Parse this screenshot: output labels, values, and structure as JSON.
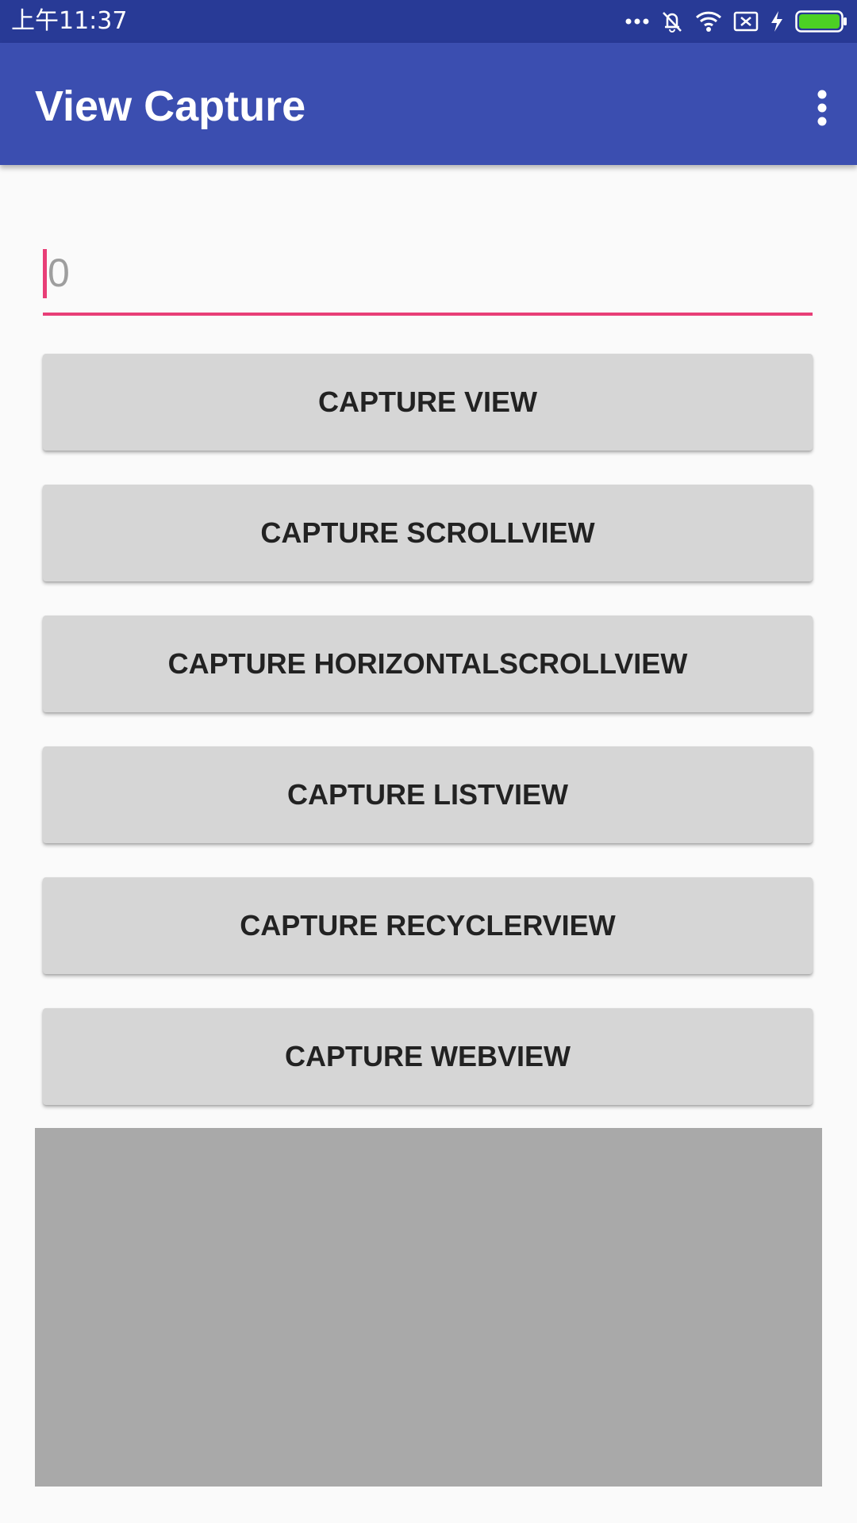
{
  "status_bar": {
    "time": "上午11:37",
    "icons": [
      "more-dots-icon",
      "mute-vibrate-icon",
      "wifi-icon",
      "no-sim-icon",
      "charging-bolt-icon",
      "battery-icon"
    ],
    "battery_color": "#4cd124"
  },
  "app_bar": {
    "title": "View Capture",
    "overflow_icon": "overflow-menu-icon",
    "color": "#3b4eb0"
  },
  "input": {
    "placeholder": "0",
    "accent_color": "#e83e77"
  },
  "buttons": [
    {
      "label": "CAPTURE VIEW"
    },
    {
      "label": "CAPTURE SCROLLVIEW"
    },
    {
      "label": "CAPTURE HORIZONTALSCROLLVIEW"
    },
    {
      "label": "CAPTURE LISTVIEW"
    },
    {
      "label": "CAPTURE RECYCLERVIEW"
    },
    {
      "label": "CAPTURE WEBVIEW"
    }
  ],
  "preview": {
    "color": "#a9a9a9"
  }
}
